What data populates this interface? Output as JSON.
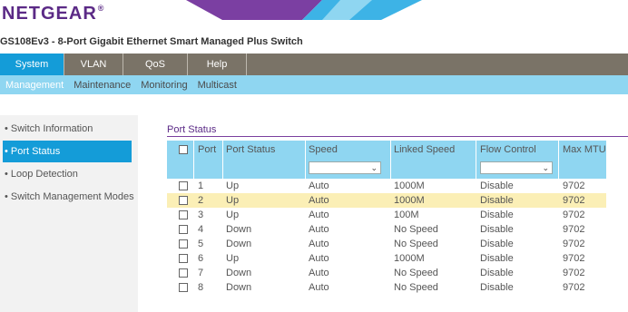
{
  "brand": {
    "logo_text": "NETGEAR",
    "reg_mark": "®"
  },
  "device_title": "GS108Ev3 - 8-Port Gigabit Ethernet Smart Managed Plus Switch",
  "colors": {
    "nav_bg": "#7a7367",
    "accent_blue": "#149cd8",
    "subnav_bg": "#8fd6f1",
    "brand_purple": "#5b2a86",
    "highlight_row": "#fbefb6"
  },
  "main_nav": {
    "tabs": [
      {
        "label": "System",
        "active": true
      },
      {
        "label": "VLAN",
        "active": false
      },
      {
        "label": "QoS",
        "active": false
      },
      {
        "label": "Help",
        "active": false
      }
    ]
  },
  "sub_nav": {
    "items": [
      {
        "label": "Management",
        "active": true
      },
      {
        "label": "Maintenance",
        "active": false
      },
      {
        "label": "Monitoring",
        "active": false
      },
      {
        "label": "Multicast",
        "active": false
      }
    ]
  },
  "sidebar": {
    "items": [
      {
        "label": "Switch Information",
        "active": false
      },
      {
        "label": "Port Status",
        "active": true
      },
      {
        "label": "Loop Detection",
        "active": false
      },
      {
        "label": "Switch Management Modes",
        "active": false
      }
    ]
  },
  "section": {
    "title": "Port Status"
  },
  "table": {
    "headers": [
      "Port",
      "Port Status",
      "Speed",
      "Linked Speed",
      "Flow Control",
      "Max MTU"
    ],
    "filter_speed_value": "",
    "filter_flow_value": "",
    "rows": [
      {
        "port": "1",
        "status": "Up",
        "speed": "Auto",
        "linked": "1000M",
        "flow": "Disable",
        "mtu": "9702",
        "highlighted": false
      },
      {
        "port": "2",
        "status": "Up",
        "speed": "Auto",
        "linked": "1000M",
        "flow": "Disable",
        "mtu": "9702",
        "highlighted": true
      },
      {
        "port": "3",
        "status": "Up",
        "speed": "Auto",
        "linked": "100M",
        "flow": "Disable",
        "mtu": "9702",
        "highlighted": false
      },
      {
        "port": "4",
        "status": "Down",
        "speed": "Auto",
        "linked": "No Speed",
        "flow": "Disable",
        "mtu": "9702",
        "highlighted": false
      },
      {
        "port": "5",
        "status": "Down",
        "speed": "Auto",
        "linked": "No Speed",
        "flow": "Disable",
        "mtu": "9702",
        "highlighted": false
      },
      {
        "port": "6",
        "status": "Up",
        "speed": "Auto",
        "linked": "1000M",
        "flow": "Disable",
        "mtu": "9702",
        "highlighted": false
      },
      {
        "port": "7",
        "status": "Down",
        "speed": "Auto",
        "linked": "No Speed",
        "flow": "Disable",
        "mtu": "9702",
        "highlighted": false
      },
      {
        "port": "8",
        "status": "Down",
        "speed": "Auto",
        "linked": "No Speed",
        "flow": "Disable",
        "mtu": "9702",
        "highlighted": false
      }
    ]
  }
}
